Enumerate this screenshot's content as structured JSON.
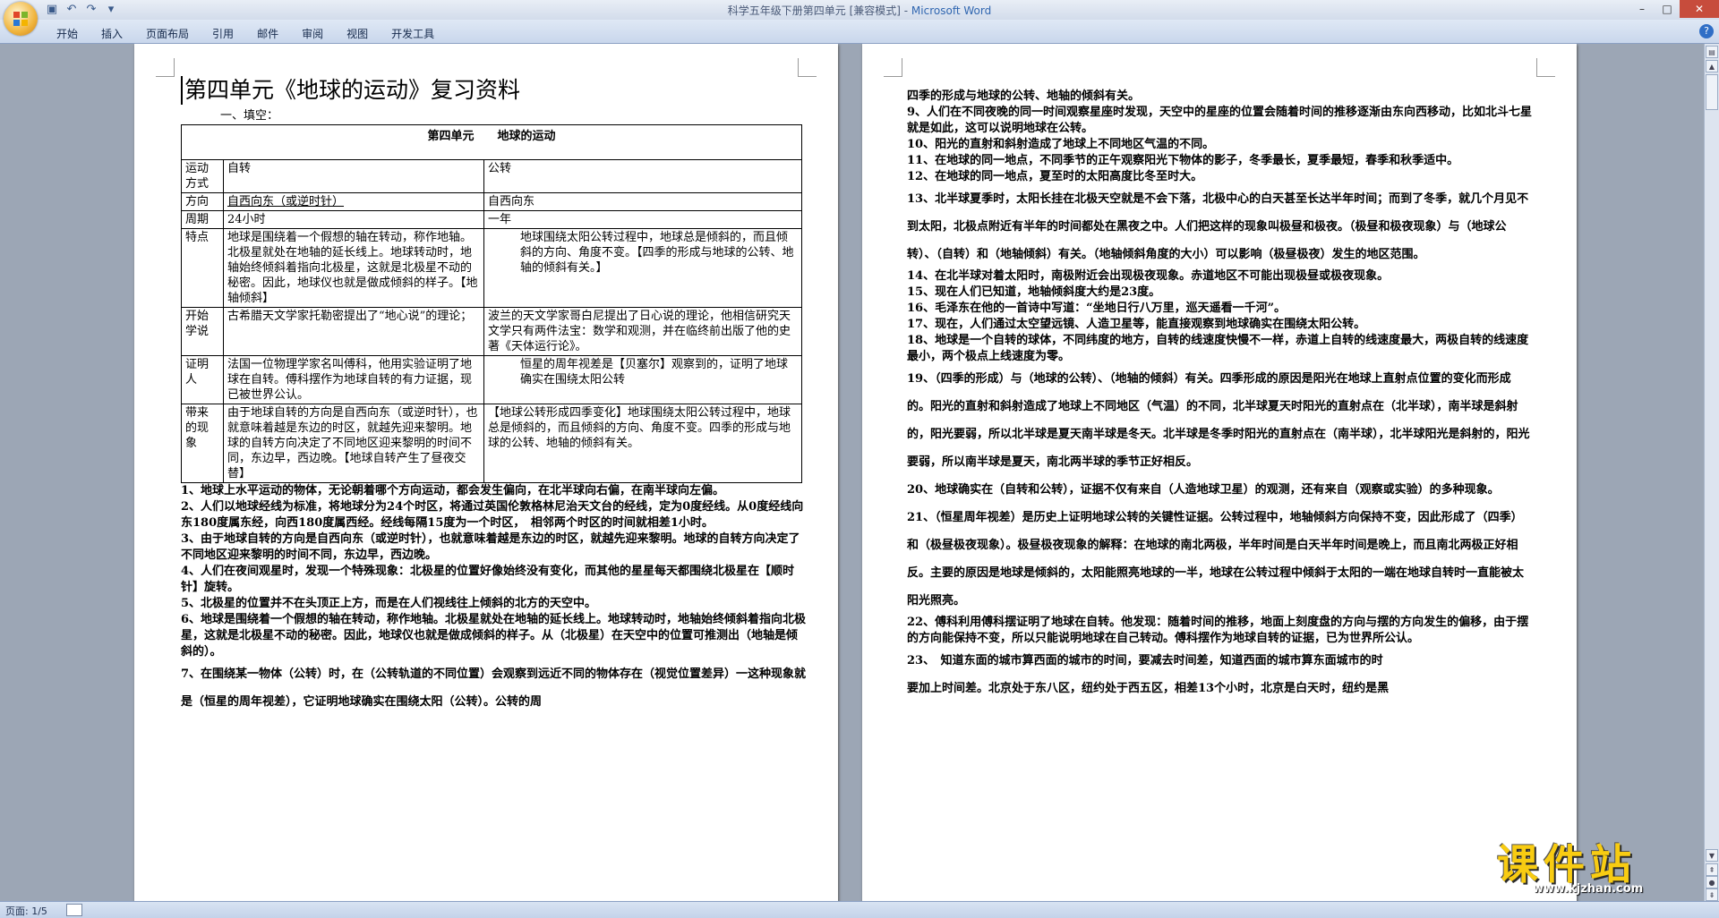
{
  "window": {
    "title": "科学五年级下册第四单元 [兼容模式] - ",
    "app_name": "Microsoft Word",
    "minimize": "–",
    "maximize": "□",
    "close": "✕"
  },
  "qat": {
    "save_icon": "save-icon",
    "undo_icon": "undo-icon",
    "redo_icon": "redo-icon",
    "customize_icon": "dropdown-icon"
  },
  "ribbon": {
    "tabs": [
      "开始",
      "插入",
      "页面布局",
      "引用",
      "邮件",
      "审阅",
      "视图",
      "开发工具"
    ],
    "help": "?"
  },
  "status": {
    "page": "页面: 1/5"
  },
  "page1": {
    "title": "第四单元《地球的运动》复习资料",
    "fill_label": "一、填空：",
    "table_header": "第四单元　　地球的运动",
    "rows": [
      {
        "label": "运动方式",
        "a": "自转",
        "b": "公转"
      },
      {
        "label": "方向",
        "a": "自西向东（或逆时针）",
        "b": "自西向东"
      },
      {
        "label": "周期",
        "a": "24小时",
        "b": "一年"
      },
      {
        "label": "特点",
        "a": "地球是围绕着一个假想的轴在转动，称作地轴。北极星就处在地轴的延长线上。地球转动时，地轴始终倾斜着指向北极星，这就是北极星不动的秘密。因此，地球仪也就是做成倾斜的样子。【地轴倾斜】",
        "b": "地球围绕太阳公转过程中，地球总是倾斜的，而且倾斜的方向、角度不变。【四季的形成与地球的公转、地轴的倾斜有关。】"
      },
      {
        "label": "开始学说",
        "a": "古希腊天文学家托勒密提出了“地心说”的理论；",
        "b": "波兰的天文学家哥白尼提出了日心说的理论，他相信研究天文学只有两件法宝：数学和观测，并在临终前出版了他的史著《天体运行论》。"
      },
      {
        "label": "证明人",
        "a": "法国一位物理学家名叫傅科，他用实验证明了地球在自转。傅科摆作为地球自转的有力证据，现已被世界公认。",
        "b": "恒星的周年视差是【贝塞尔】观察到的，证明了地球确实在围绕太阳公转"
      },
      {
        "label": "带来的现象",
        "a": "由于地球自转的方向是自西向东（或逆时针），也就意味着越是东边的时区，就越先迎来黎明。地球的自转方向决定了不同地区迎来黎明的时间不同，东边早，西边晚。【地球自转产生了昼夜交替】",
        "b": "【地球公转形成四季变化】地球围绕太阳公转过程中，地球总是倾斜的，而且倾斜的方向、角度不变。四季的形成与地球的公转、地轴的倾斜有关。"
      }
    ],
    "items": [
      "1、地球上水平运动的物体，无论朝着哪个方向运动，都会发生偏向，在北半球向右偏，在南半球向左偏。",
      "2、人们以地球经线为标准，将地球分为24个时区，将通过英国伦敦格林尼治天文台的经线，定为0度经线。从0度经线向东180度属东经，向西180度属西经。经线每隔15度为一个时区，　相邻两个时区的时间就相差1小时。",
      "3、由于地球自转的方向是自西向东（或逆时针），也就意味着越是东边的时区，就越先迎来黎明。地球的自转方向决定了不同地区迎来黎明的时间不同，东边早，西边晚。",
      "4、人们在夜间观星时，发现一个特殊现象：北极星的位置好像始终没有变化，而其他的星星每天都围绕北极星在【顺时针】旋转。",
      "5、北极星的位置并不在头顶正上方，而是在人们视线往上倾斜的北方的天空中。",
      "6、地球是围绕着一个假想的轴在转动，称作地轴。北极星就处在地轴的延长线上。地球转动时，地轴始终倾斜着指向北极星，这就是北极星不动的秘密。因此，地球仪也就是做成倾斜的样子。从（北极星）在天空中的位置可推测出（地轴是倾斜的）。",
      "7、在围绕某一物体（公转）时，在（公转轨道的不同位置）会观察到远近不同的物体存在（视觉位置差异）一这种现象就是（恒星的周年视差），它证明地球确实在围绕太阳（公转）。公转的周"
    ]
  },
  "page2": {
    "items": [
      "四季的形成与地球的公转、地轴的倾斜有关。",
      "9、人们在不同夜晚的同一时间观察星座时发现，天空中的星座的位置会随着时间的推移逐渐由东向西移动，比如北斗七星就是如此，这可以说明地球在公转。",
      "10、阳光的直射和斜射造成了地球上不同地区气温的不同。",
      "11、在地球的同一地点，不同季节的正午观察阳光下物体的影子，冬季最长，夏季最短，春季和秋季适中。",
      "12、在地球的同一地点，夏至时的太阳高度比冬至时大。",
      "13、北半球夏季时，太阳长挂在北极天空就是不会下落，北极中心的白天甚至长达半年时间；而到了冬季，就几个月见不到太阳，北极点附近有半年的时间都处在黑夜之中。人们把这样的现象叫极昼和极夜。（极昼和极夜现象）与（地球公转）、（自转）和（地轴倾斜）有关。（地轴倾斜角度的大小）可以影响（极昼极夜）发生的地区范围。",
      "14、在北半球对着太阳时，南极附近会出现极夜现象。赤道地区不可能出现极昼或极夜现象。",
      "15、现在人们已知道，地轴倾斜度大约是23度。",
      "16、毛泽东在他的一首诗中写道：“坐地日行八万里，巡天遥看一千河”。",
      "17、现在，人们通过太空望远镜、人造卫星等，能直接观察到地球确实在围绕太阳公转。",
      "18、地球是一个自转的球体，不同纬度的地方，自转的线速度快慢不一样，赤道上自转的线速度最大，两极自转的线速度最小，两个极点上线速度为零。",
      "19、（四季的形成）与（地球的公转）、（地轴的倾斜）有关。四季形成的原因是阳光在地球上直射点位置的变化而形成的。阳光的直射和斜射造成了地球上不同地区（气温）的不同，北半球夏天时阳光的直射点在（北半球），南半球是斜射的，阳光要弱，所以北半球是夏天南半球是冬天。北半球是冬季时阳光的直射点在（南半球），北半球阳光是斜射的，阳光要弱，所以南半球是夏天，南北两半球的季节正好相反。",
      "20、地球确实在（自转和公转），证据不仅有来自（人造地球卫星）的观测，还有来自（观察或实验）的多种现象。",
      "21、（恒星周年视差）是历史上证明地球公转的关键性证据。公转过程中，地轴倾斜方向保持不变，因此形成了（四季）和（极昼极夜现象）。极昼极夜现象的解释：在地球的南北两极，半年时间是白天半年时间是晚上，而且南北两极正好相反。主要的原因是地球是倾斜的，太阳能照亮地球的一半，地球在公转过程中倾斜于太阳的一端在地球自转时一直能被太阳光照亮。",
      "22、傅科利用傅科摆证明了地球在自转。他发现：随着时间的推移，地面上刻度盘的方向与摆的方向发生的偏移，由于摆的方向能保持不变，所以只能说明地球在自己转动。傅科摆作为地球自转的证据，已为世界所公认。",
      "23、　知道东面的城市算西面的城市的时间，要减去时间差，知道西面的城市算东面城市的时",
      "要加上时间差。北京处于东八区，纽约处于西五区，相差13个小时，北京是白天时，纽约是黑"
    ]
  },
  "watermark": {
    "text": "课件站",
    "url": "www.kjzhan.com"
  }
}
